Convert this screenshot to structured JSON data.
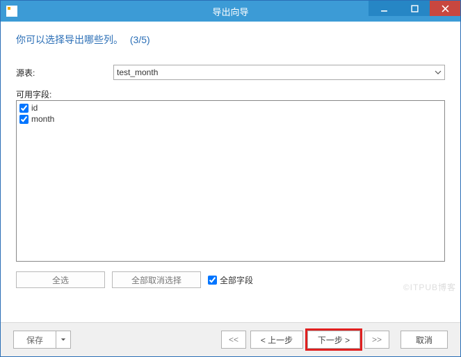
{
  "titlebar": {
    "title": "导出向导"
  },
  "heading": {
    "text": "你可以选择导出哪些列。",
    "step": "(3/5)"
  },
  "source": {
    "label": "源表:",
    "value": "test_month"
  },
  "fields": {
    "label": "可用字段:",
    "items": [
      {
        "name": "id",
        "checked": true
      },
      {
        "name": "month",
        "checked": true
      }
    ]
  },
  "selection": {
    "select_all": "全选",
    "deselect_all": "全部取消选择",
    "all_fields_label": "全部字段",
    "all_fields_checked": true
  },
  "footer": {
    "save": "保存",
    "first": "<<",
    "prev": "< 上一步",
    "next": "下一步 >",
    "last": ">>",
    "cancel": "取消"
  },
  "watermark": "©ITPUB博客"
}
